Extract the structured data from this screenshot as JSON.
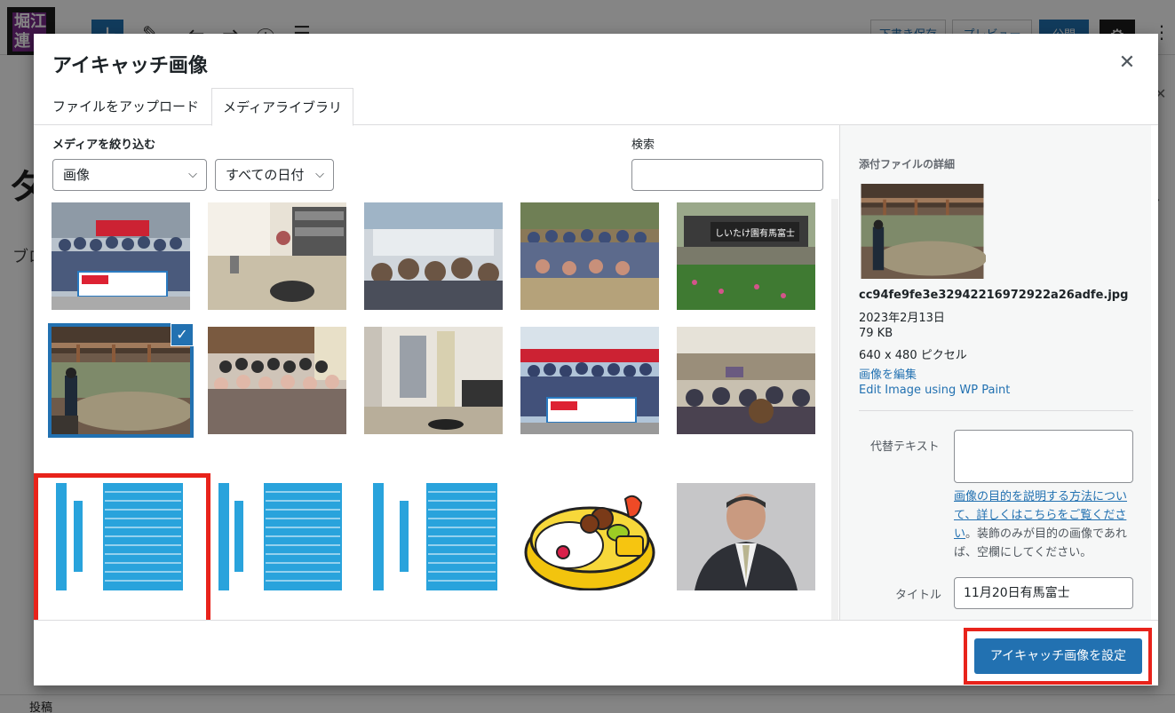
{
  "background": {
    "logo_text": "堀江\n連",
    "draft_label": "下書き保存",
    "preview_label": "プレビュー",
    "publish_label": "公開",
    "big_letter": "タ",
    "small_text": "ブロ",
    "footer_label": "投稿"
  },
  "modal": {
    "title": "アイキャッチ画像",
    "close_icon": "close-icon"
  },
  "tabs": [
    {
      "label": "ファイルをアップロード"
    },
    {
      "label": "メディアライブラリ",
      "active": true
    }
  ],
  "filters": {
    "label": "メディアを絞り込む",
    "type_value": "画像",
    "date_value": "すべての日付",
    "search_label": "検索",
    "search_value": ""
  },
  "details": {
    "title": "添付ファイルの詳細",
    "filename": "cc94fe9fe3e32942216972922a26adfe.jpg",
    "date": "2023年2月13日",
    "size": "79 KB",
    "dimensions": "640 x 480 ピクセル",
    "edit_link": "画像を編集",
    "wp_paint_link": "Edit Image using WP Paint",
    "alt_label": "代替テキスト",
    "alt_value": "",
    "alt_help_link": "画像の目的を説明する方法について、詳しくはこちらをご覧ください",
    "alt_help_rest": "。装飾のみが目的の画像であれば、空欄にしてください。",
    "title_label": "タイトル",
    "title_value": "11月20日有馬富士"
  },
  "sign_text": "しいたけ園有馬富士",
  "footer": {
    "set_button": "アイキャッチ画像を設定"
  },
  "colors": {
    "primary": "#2271b1",
    "highlight": "#e8231b"
  }
}
